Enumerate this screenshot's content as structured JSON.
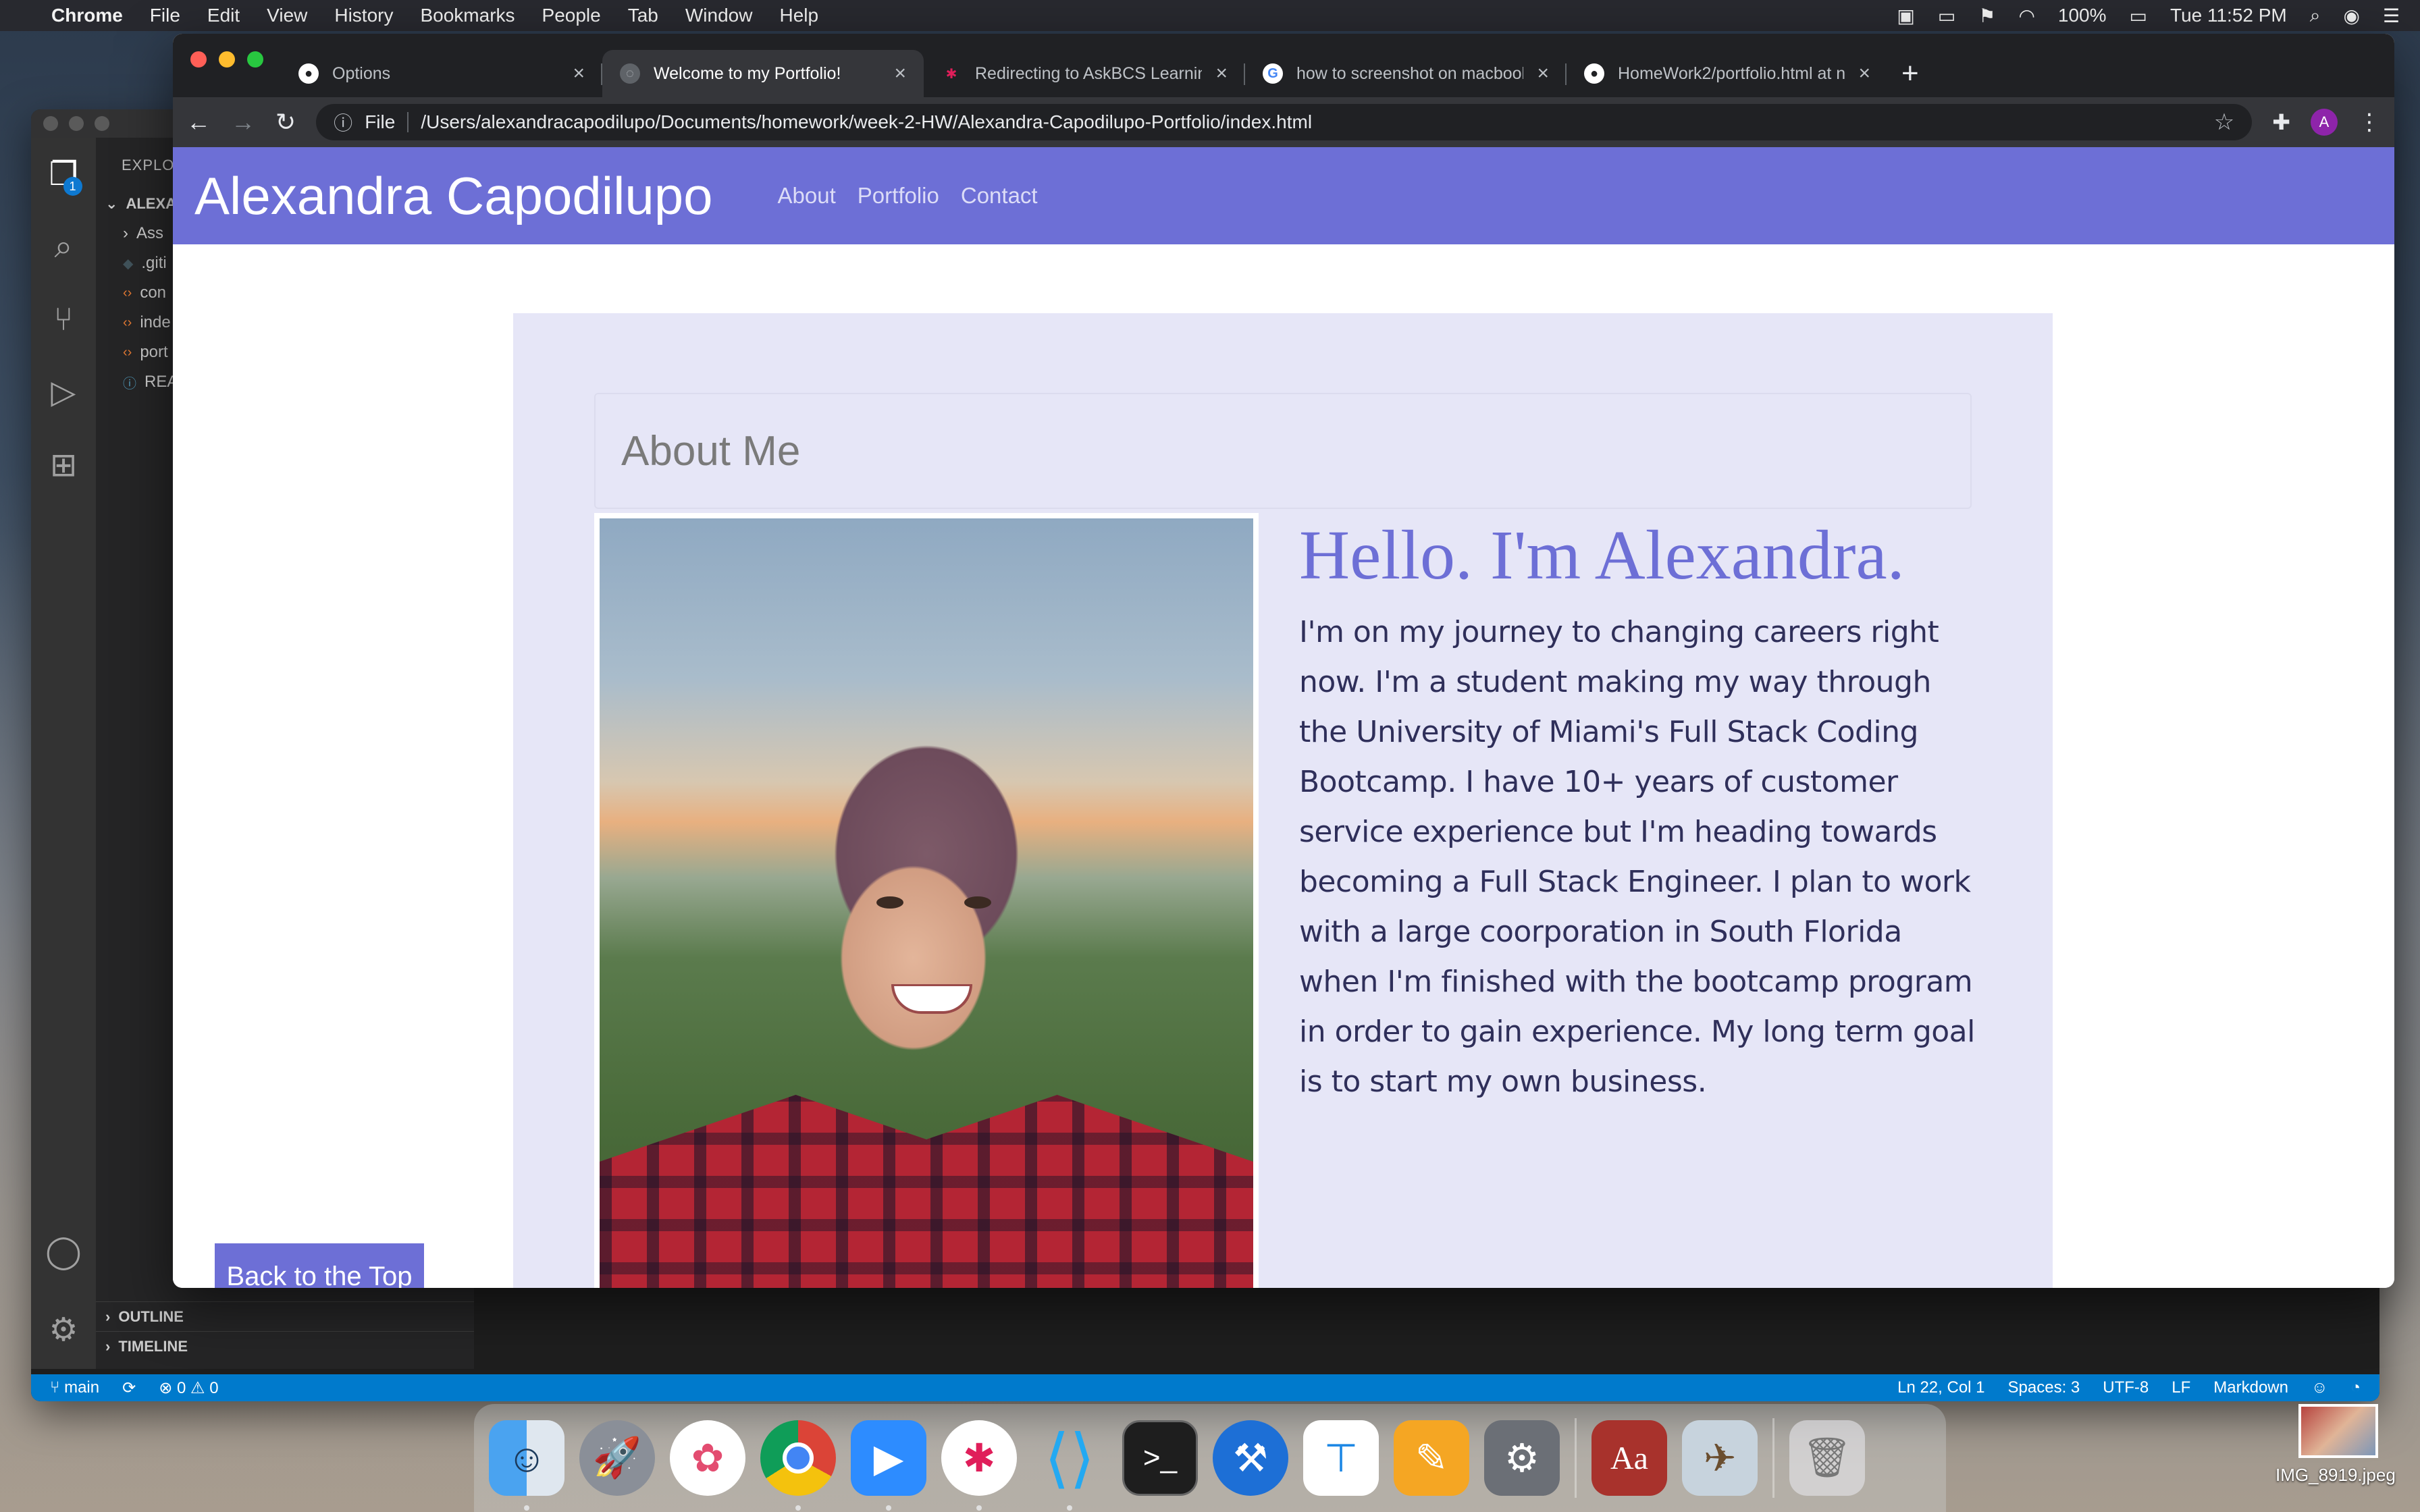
{
  "menubar": {
    "app_name": "Chrome",
    "items": [
      "File",
      "Edit",
      "View",
      "History",
      "Bookmarks",
      "People",
      "Tab",
      "Window",
      "Help"
    ],
    "battery": "100%",
    "clock": "Tue 11:52 PM"
  },
  "vscode": {
    "explorer_title": "EXPLO",
    "root_folder": "ALEXA",
    "files": [
      {
        "name": "Ass",
        "icon": "chevron-right-icon"
      },
      {
        "name": ".giti",
        "icon": "git-icon"
      },
      {
        "name": "con",
        "icon": "html-icon"
      },
      {
        "name": "inde",
        "icon": "html-icon"
      },
      {
        "name": "port",
        "icon": "html-icon"
      },
      {
        "name": "REA",
        "icon": "info-icon"
      }
    ],
    "sections": [
      "OUTLINE",
      "TIMELINE"
    ],
    "explorer_badge": "1",
    "status": {
      "branch": "main",
      "problems": "0",
      "warnings": "0",
      "position": "Ln 22, Col 1",
      "spaces": "Spaces: 3",
      "encoding": "UTF-8",
      "eol": "LF",
      "language": "Markdown"
    }
  },
  "chrome": {
    "tabs": [
      {
        "title": "Options",
        "favicon": "github-icon",
        "active": false
      },
      {
        "title": "Welcome to my Portfolio!",
        "favicon": "globe-icon",
        "active": true
      },
      {
        "title": "Redirecting to AskBCS Learnin",
        "favicon": "slack-icon",
        "active": false
      },
      {
        "title": "how to screenshot on macbool",
        "favicon": "google-icon",
        "active": false
      },
      {
        "title": "HomeWork2/portfolio.html at n",
        "favicon": "github-icon",
        "active": false
      }
    ],
    "omnibox": {
      "scheme": "File",
      "url": "/Users/alexandracapodilupo/Documents/homework/week-2-HW/Alexandra-Capodilupo-Portfolio/index.html"
    },
    "profile_initial": "A"
  },
  "site": {
    "title": "Alexandra Capodilupo",
    "nav": [
      "About",
      "Portfolio",
      "Contact"
    ],
    "about_heading": "About Me",
    "greeting": "Hello. I'm Alexandra.",
    "bio": "I'm on my journey to changing careers right now. I'm a student making my way through the University of Miami's Full Stack Coding Bootcamp. I have 10+ years of customer service experience but I'm heading towards becoming a Full Stack Engineer. I plan to work with a large coorporation in South Florida when I'm finished with the bootcamp program in order to gain experience. My long term goal is to start my own business.",
    "back_to_top": "Back to the Top",
    "accent_color": "#6d6fd6"
  },
  "dock": {
    "apps": [
      "Finder",
      "Launchpad",
      "Photos",
      "Chrome",
      "Zoom",
      "Slack",
      "Visual Studio Code",
      "Terminal",
      "Xcode",
      "Keynote",
      "Pages",
      "System Preferences",
      "Dictionary",
      "Preview",
      "Trash"
    ],
    "dictionary_label": "Aa"
  },
  "desktop": {
    "file_label": "IMG_8919.jpeg"
  }
}
